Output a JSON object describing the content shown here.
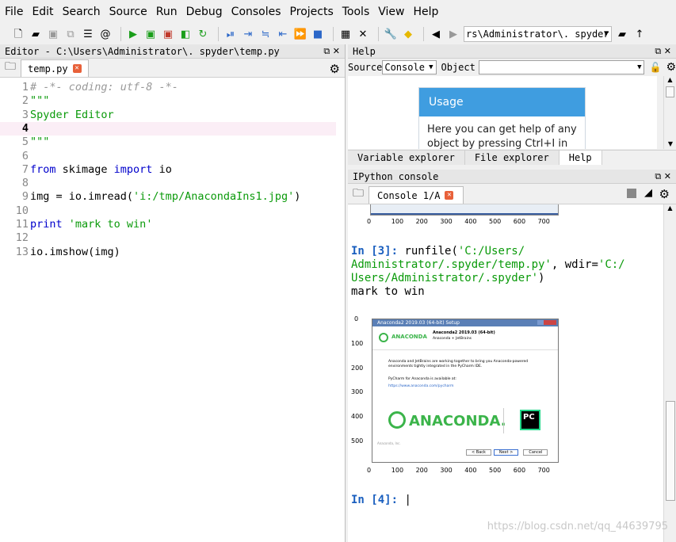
{
  "menubar": {
    "items": [
      "File",
      "Edit",
      "Search",
      "Source",
      "Run",
      "Debug",
      "Consoles",
      "Projects",
      "Tools",
      "View",
      "Help"
    ]
  },
  "toolbar": {
    "path": "rs\\Administrator\\. spyder",
    "icons": [
      "new-file-icon",
      "open-file-icon",
      "save-icon",
      "save-all-icon",
      "browse-tabs-icon",
      "at-icon",
      "run-icon",
      "run-cell-icon",
      "run-cell-advance-icon",
      "run-selection-icon",
      "re-run-icon",
      "debug-icon",
      "step-icon",
      "step-into-icon",
      "step-return-icon",
      "continue-icon",
      "stop-icon",
      "maximize-pane-icon",
      "fullscreen-icon",
      "wrench-icon",
      "python-icon",
      "back-icon",
      "forward-icon",
      "browse-icon",
      "up-icon"
    ]
  },
  "editor": {
    "title": "Editor - C:\\Users\\Administrator\\. spyder\\temp.py",
    "tab_label": "temp.py",
    "current_line": 4,
    "lines": [
      {
        "n": "1",
        "segments": [
          {
            "t": "# -*- coding: utf-8 -*-",
            "c": "comment"
          }
        ]
      },
      {
        "n": "2",
        "segments": [
          {
            "t": "\"\"\"",
            "c": "string"
          }
        ]
      },
      {
        "n": "3",
        "segments": [
          {
            "t": "Spyder Editor",
            "c": "string"
          }
        ]
      },
      {
        "n": "4",
        "segments": [
          {
            "t": "",
            "c": "plain"
          }
        ]
      },
      {
        "n": "5",
        "segments": [
          {
            "t": "\"\"\"",
            "c": "string"
          }
        ]
      },
      {
        "n": "6",
        "segments": [
          {
            "t": "",
            "c": "plain"
          }
        ]
      },
      {
        "n": "7",
        "segments": [
          {
            "t": "from",
            "c": "kw"
          },
          {
            "t": " skimage ",
            "c": "plain"
          },
          {
            "t": "import",
            "c": "kw"
          },
          {
            "t": " io",
            "c": "plain"
          }
        ]
      },
      {
        "n": "8",
        "segments": [
          {
            "t": "",
            "c": "plain"
          }
        ]
      },
      {
        "n": "9",
        "segments": [
          {
            "t": "img = io.imread(",
            "c": "plain"
          },
          {
            "t": "'i:/tmp/AnacondaIns1.jpg'",
            "c": "string"
          },
          {
            "t": ")",
            "c": "plain"
          }
        ]
      },
      {
        "n": "10",
        "segments": [
          {
            "t": "",
            "c": "plain"
          }
        ]
      },
      {
        "n": "11",
        "segments": [
          {
            "t": "print",
            "c": "kw"
          },
          {
            "t": " ",
            "c": "plain"
          },
          {
            "t": "'mark to win'",
            "c": "string"
          }
        ]
      },
      {
        "n": "12",
        "segments": [
          {
            "t": "",
            "c": "plain"
          }
        ]
      },
      {
        "n": "13",
        "segments": [
          {
            "t": "io.imshow(img)",
            "c": "plain"
          }
        ]
      }
    ]
  },
  "help": {
    "title": "Help",
    "source_label": "Source",
    "source_value": "Console",
    "object_label": "Object",
    "usage_title": "Usage",
    "usage_text_1": "Here you can get help of any",
    "usage_text_2": "object by pressing Ctrl+I in",
    "tabs": [
      "Variable explorer",
      "File explorer",
      "Help"
    ]
  },
  "console": {
    "title": "IPython console",
    "tab_label": "Console 1/A",
    "top_ticks": [
      "0",
      "100",
      "200",
      "300",
      "400",
      "500",
      "600",
      "700"
    ],
    "prompt3": "In [3]:",
    "cmd_a": " runfile(",
    "cmd_b": "'C:/Users/",
    "cmd_c": "Administrator/.spyder/temp.py'",
    "cmd_d": ", wdir=",
    "cmd_e": "'C:/",
    "cmd_f": "Users/Administrator/.spyder'",
    "cmd_g": ")",
    "output": "mark to win",
    "y_ticks": [
      "0",
      "100",
      "200",
      "300",
      "400",
      "500"
    ],
    "x_ticks": [
      "0",
      "100",
      "200",
      "300",
      "400",
      "500",
      "600",
      "700"
    ],
    "prompt4": "In [4]:",
    "cursor": " |",
    "image": {
      "window_title": "Anaconda2 2019.03 (64-bit) Setup",
      "header_title": "Anaconda2 2019.03 (64-bit)",
      "header_sub": "Anaconda + JetBrains",
      "brand_small": "ANACONDA",
      "body_1": "Anaconda and JetBrains are working together to bring you Anaconda-powered",
      "body_2": "environments tightly integrated in the PyCharm IDE.",
      "body_3": "PyCharm for Anaconda is available at:",
      "body_link": "https://www.anaconda.com/pycharm",
      "brand_big": "ANACONDA.",
      "pc": "PC",
      "btn_back": "< Back",
      "btn_next": "Next >",
      "btn_cancel": "Cancel",
      "footer": "Anaconda, Inc."
    }
  },
  "watermark": "https://blog.csdn.net/qq_44639795"
}
